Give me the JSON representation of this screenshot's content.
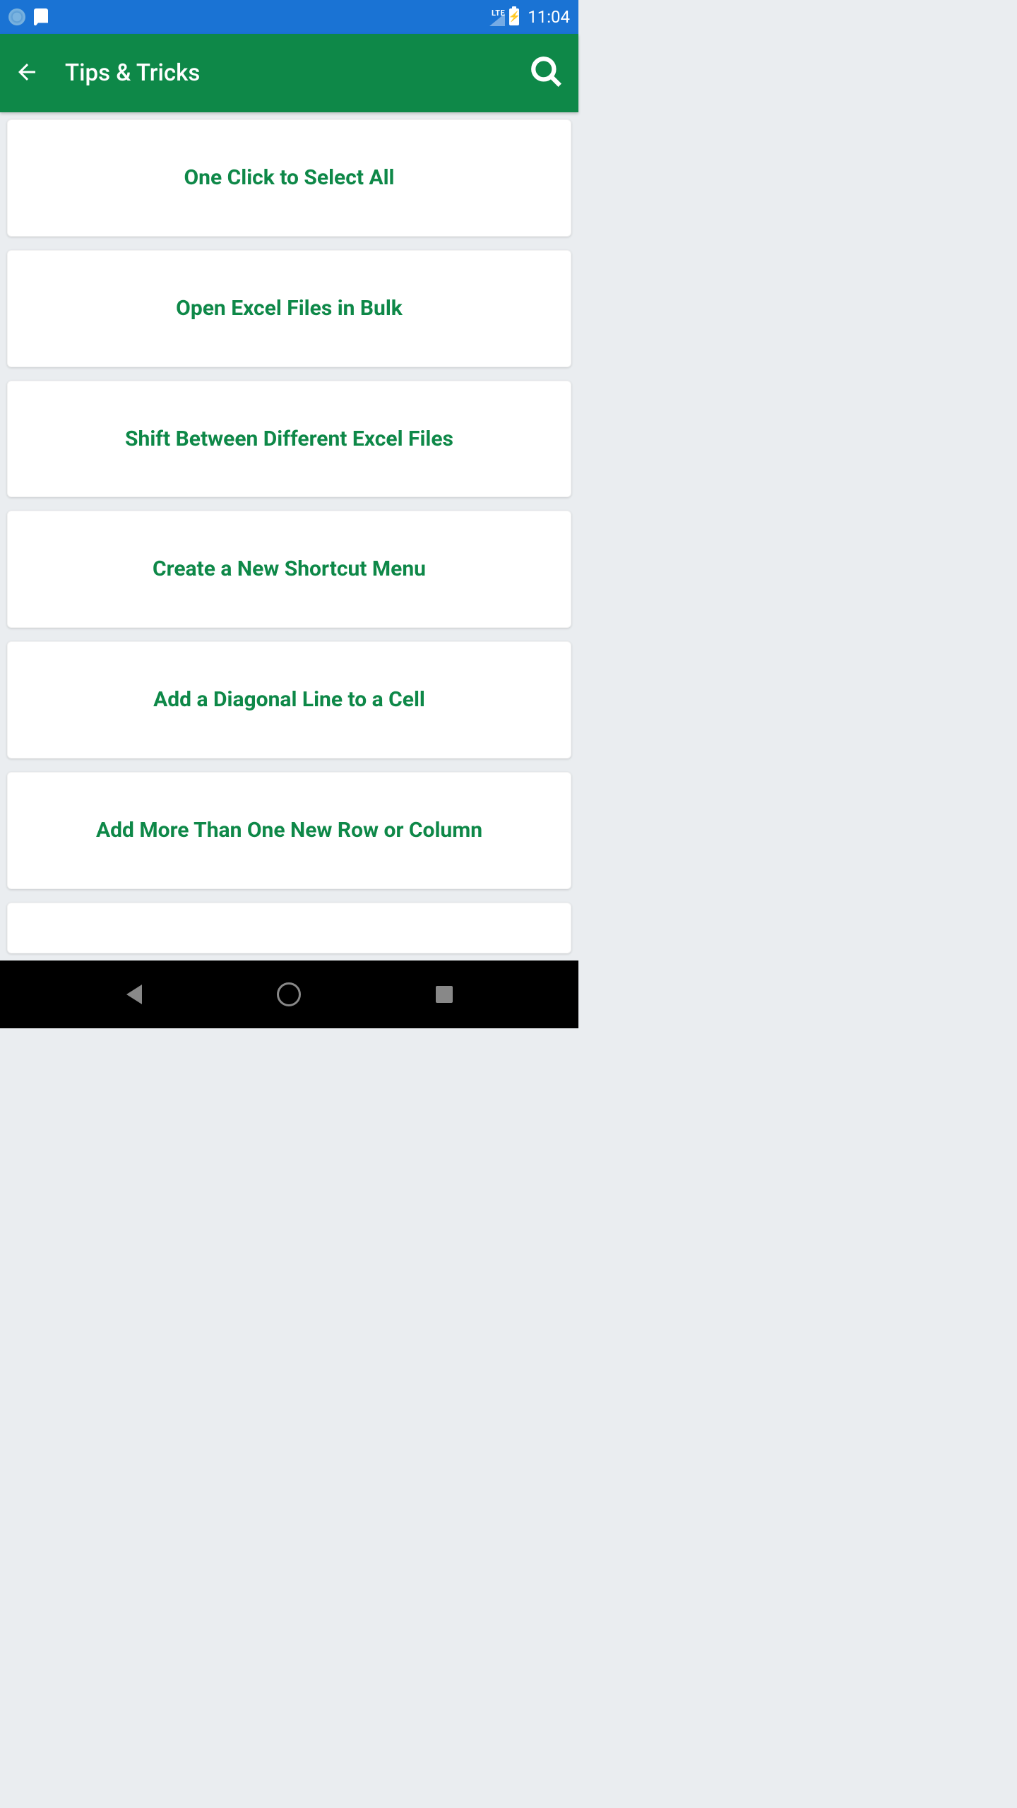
{
  "status_bar": {
    "network_type": "LTE",
    "time": "11:04"
  },
  "app_bar": {
    "title": "Tips & Tricks"
  },
  "tips": [
    {
      "title": "One Click to Select All"
    },
    {
      "title": "Open Excel Files in Bulk"
    },
    {
      "title": "Shift Between Different Excel Files"
    },
    {
      "title": "Create a New Shortcut Menu"
    },
    {
      "title": "Add a Diagonal Line to a Cell"
    },
    {
      "title": "Add More Than One New Row or Column"
    }
  ],
  "colors": {
    "status_bar_bg": "#1a73d4",
    "app_bar_bg": "#0e8848",
    "accent": "#0e8848",
    "body_bg": "#eaedf0",
    "card_bg": "#ffffff"
  }
}
